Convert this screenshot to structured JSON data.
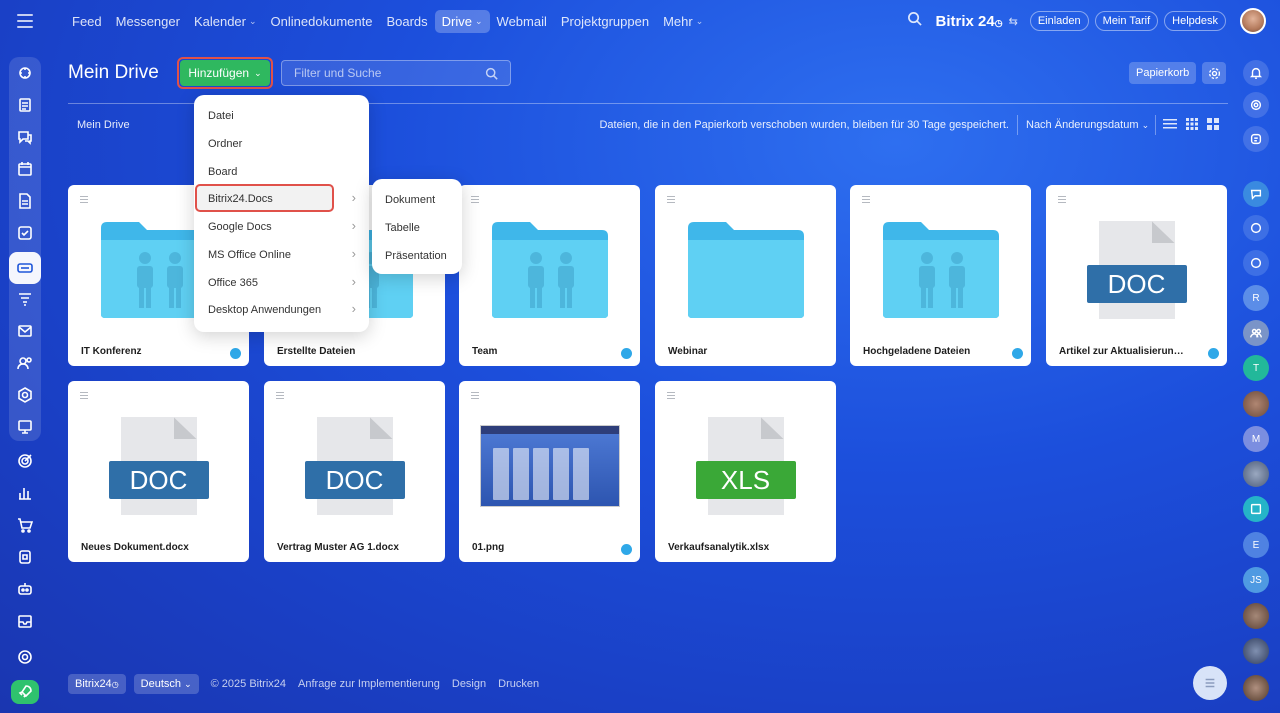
{
  "nav": {
    "items": [
      {
        "label": "Feed",
        "chevron": false,
        "active": false
      },
      {
        "label": "Messenger",
        "chevron": false,
        "active": false
      },
      {
        "label": "Kalender",
        "chevron": true,
        "active": false
      },
      {
        "label": "Onlinedokumente",
        "chevron": false,
        "active": false
      },
      {
        "label": "Boards",
        "chevron": false,
        "active": false
      },
      {
        "label": "Drive",
        "chevron": true,
        "active": true
      },
      {
        "label": "Webmail",
        "chevron": false,
        "active": false
      },
      {
        "label": "Projektgruppen",
        "chevron": false,
        "active": false
      },
      {
        "label": "Mehr",
        "chevron": true,
        "active": false
      }
    ],
    "brand": "Bitrix 24",
    "invite": "Einladen",
    "tariff": "Mein Tarif",
    "helpdesk": "Helpdesk"
  },
  "page": {
    "title": "Mein Drive",
    "add_button": "Hinzufügen",
    "filter_placeholder": "Filter und Suche",
    "trash": "Papierkorb",
    "breadcrumb": "Mein Drive",
    "info": "Dateien, die in den Papierkorb verschoben wurden, bleiben für 30 Tage gespeichert.",
    "sort": "Nach Änderungsdatum"
  },
  "add_menu": {
    "items": [
      {
        "label": "Datei",
        "submenu": false
      },
      {
        "label": "Ordner",
        "submenu": false
      },
      {
        "label": "Board",
        "submenu": false
      },
      {
        "label": "Bitrix24.Docs",
        "submenu": true
      },
      {
        "label": "Google Docs",
        "submenu": true
      },
      {
        "label": "MS Office Online",
        "submenu": true
      },
      {
        "label": "Office 365",
        "submenu": true
      },
      {
        "label": "Desktop Anwendungen",
        "submenu": true
      }
    ],
    "submenu_items": [
      "Dokument",
      "Tabelle",
      "Präsentation"
    ]
  },
  "tiles": [
    {
      "label": "IT Konferenz",
      "kind": "folder-shared",
      "shared": true
    },
    {
      "label": "Erstellte Dateien",
      "kind": "folder-shared",
      "shared": false
    },
    {
      "label": "Team",
      "kind": "folder-shared",
      "shared": true
    },
    {
      "label": "Webinar",
      "kind": "folder",
      "shared": false
    },
    {
      "label": "Hochgeladene Dateien",
      "kind": "folder-shared",
      "shared": true
    },
    {
      "label": "Artikel zur Aktualisierung (Mia...",
      "kind": "doc",
      "shared": true
    },
    {
      "label": "Neues Dokument.docx",
      "kind": "doc",
      "shared": false
    },
    {
      "label": "Vertrag Muster AG 1.docx",
      "kind": "doc",
      "shared": false
    },
    {
      "label": "01.png",
      "kind": "image",
      "shared": true
    },
    {
      "label": "Verkaufsanalytik.xlsx",
      "kind": "xls",
      "shared": false
    }
  ],
  "file_badges": {
    "doc": "DOC",
    "xls": "XLS"
  },
  "colors": {
    "accent_green": "#2fb85f",
    "doc_blue": "#2f6fa8",
    "xls_green": "#3aa837",
    "folder_blue": "#5fd0f3",
    "highlight_red": "#e0514a"
  },
  "footer": {
    "brand": "Bitrix24",
    "language": "Deutsch",
    "copyright": "© 2025 Bitrix24",
    "implementation": "Anfrage zur Implementierung",
    "design": "Design",
    "print": "Drucken"
  },
  "right_rail_letters": [
    "R",
    "T",
    "M",
    "E",
    "JS"
  ]
}
